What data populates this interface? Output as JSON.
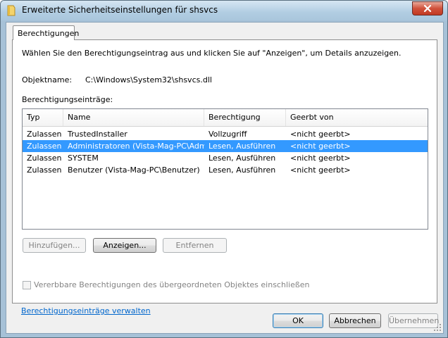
{
  "window": {
    "title": "Erweiterte Sicherheitseinstellungen für shsvcs",
    "close_label": "Schließen"
  },
  "tabs": [
    {
      "label": "Berechtigungen",
      "active": true
    }
  ],
  "intro_text": "Wählen Sie den Berechtigungseintrag aus und klicken Sie auf \"Anzeigen\", um Details anzuzeigen.",
  "object": {
    "label": "Objektname:",
    "value": "C:\\Windows\\System32\\shsvcs.dll"
  },
  "entries_label": "Berechtigungseinträge:",
  "table": {
    "columns": [
      "Typ",
      "Name",
      "Berechtigung",
      "Geerbt von"
    ],
    "rows": [
      [
        "Zulassen",
        "TrustedInstaller",
        "Vollzugriff",
        "<nicht geerbt>"
      ],
      [
        "Zulassen",
        "Administratoren (Vista-Mag-PC\\Admi...",
        "Lesen, Ausführen",
        "<nicht geerbt>"
      ],
      [
        "Zulassen",
        "SYSTEM",
        "Lesen, Ausführen",
        "<nicht geerbt>"
      ],
      [
        "Zulassen",
        "Benutzer (Vista-Mag-PC\\Benutzer)",
        "Lesen, Ausführen",
        "<nicht geerbt>"
      ]
    ],
    "selected_row": 1
  },
  "buttons": {
    "add": "Hinzufügen...",
    "view": "Anzeigen...",
    "remove": "Entfernen"
  },
  "inherit_checkbox": {
    "label": "Vererbbare Berechtigungen des übergeordneten Objektes einschließen",
    "checked": false,
    "enabled": false
  },
  "manage_link": "Berechtigungseinträge verwalten",
  "footer": {
    "ok": "OK",
    "cancel": "Abbrechen",
    "apply": "Übernehmen"
  },
  "icons": {
    "window_icon": "folder-icon",
    "close": "close-icon"
  },
  "colors": {
    "selection": "#3399ff",
    "link": "#0066cc",
    "close_button": "#c23a22"
  }
}
